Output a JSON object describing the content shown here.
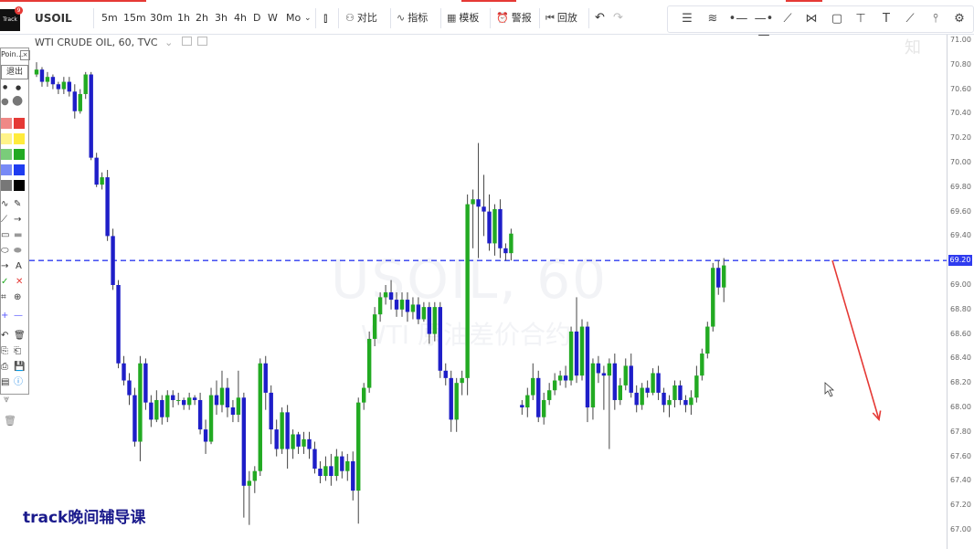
{
  "toolbar": {
    "symbol": "USOIL",
    "intervals": [
      "5m",
      "15m",
      "30m",
      "1h",
      "2h",
      "3h",
      "4h",
      "D",
      "W",
      "Mo"
    ],
    "compare": "对比",
    "indicators": "指标",
    "templates": "模板",
    "alert": "警报",
    "replay": "回放"
  },
  "drawing_tools": [
    "horizontal-lines-icon",
    "parallel-channel-icon",
    "horizontal-ray-icon",
    "horizontal-line-icon",
    "trend-line-icon",
    "pattern-icon",
    "rectangle-icon",
    "text-anchor-icon",
    "text-icon",
    "brush-icon",
    "vertical-line-icon",
    "settings-icon"
  ],
  "chart_header": {
    "title": "WTI CRUDE OIL, 60, TVC"
  },
  "watermark": {
    "symbol": "USOIL, 60",
    "name": "WTI 原油差价合约"
  },
  "left_panel": {
    "top_label": "Poin...",
    "exit_button": "退出",
    "text_tool": "A",
    "colors": [
      "#e53935",
      "#ffeb3b",
      "#22aa22",
      "#1e3cf0",
      "#000000"
    ]
  },
  "caption": "track晚间辅导课",
  "logo": {
    "text": "Track",
    "badge": "9"
  },
  "corner_mark": "知",
  "chart_data": {
    "type": "candlestick",
    "y_axis_ticks": [
      "71.00",
      "70.80",
      "70.60",
      "70.40",
      "70.20",
      "70.00",
      "69.80",
      "69.60",
      "69.40",
      "69.20",
      "69.00",
      "68.80",
      "68.60",
      "68.40",
      "68.20",
      "68.00",
      "67.80",
      "67.60",
      "67.40",
      "67.20",
      "67.00"
    ],
    "ylim": [
      66.9,
      71.03
    ],
    "current_price": "69.20",
    "dashed_level": 69.2,
    "colors": {
      "up": "#22aa22",
      "down": "#1e1ec8",
      "level": "#2f3bef",
      "arrow": "#e53935"
    },
    "candles": [
      [
        70.72,
        70.76,
        70.82,
        70.7
      ],
      [
        70.76,
        70.66,
        70.78,
        70.62
      ],
      [
        70.66,
        70.7,
        70.74,
        70.62
      ],
      [
        70.7,
        70.64,
        70.72,
        70.6
      ],
      [
        70.64,
        70.6,
        70.66,
        70.56
      ],
      [
        70.6,
        70.66,
        70.7,
        70.56
      ],
      [
        70.66,
        70.58,
        70.7,
        70.54
      ],
      [
        70.58,
        70.42,
        70.64,
        70.36
      ],
      [
        70.42,
        70.56,
        70.6,
        70.4
      ],
      [
        70.56,
        70.72,
        70.74,
        70.52
      ],
      [
        70.72,
        70.04,
        70.74,
        70.02
      ],
      [
        70.04,
        69.82,
        70.08,
        69.8
      ],
      [
        69.82,
        69.88,
        69.92,
        69.78
      ],
      [
        69.88,
        69.4,
        69.94,
        69.36
      ],
      [
        69.4,
        69.0,
        69.46,
        68.96
      ],
      [
        69.0,
        68.36,
        69.04,
        68.32
      ],
      [
        68.36,
        68.22,
        68.42,
        68.18
      ],
      [
        68.22,
        68.1,
        68.28,
        68.02
      ],
      [
        68.1,
        67.72,
        68.16,
        67.68
      ],
      [
        67.72,
        68.36,
        68.42,
        67.56
      ],
      [
        68.36,
        68.04,
        68.4,
        67.98
      ],
      [
        68.04,
        67.9,
        68.1,
        67.84
      ],
      [
        67.9,
        68.06,
        68.14,
        67.88
      ],
      [
        68.06,
        67.92,
        68.1,
        67.86
      ],
      [
        67.92,
        68.1,
        68.14,
        67.88
      ],
      [
        68.1,
        68.06,
        68.14,
        68.0
      ],
      [
        68.06,
        68.06,
        68.12,
        68.02
      ],
      [
        68.06,
        68.02,
        68.08,
        67.98
      ],
      [
        68.02,
        68.08,
        68.12,
        67.98
      ],
      [
        68.08,
        68.06,
        68.1,
        68.02
      ],
      [
        68.06,
        67.82,
        68.12,
        67.78
      ],
      [
        67.82,
        67.72,
        67.9,
        67.62
      ],
      [
        67.72,
        68.1,
        68.16,
        67.7
      ],
      [
        68.1,
        68.02,
        68.22,
        67.94
      ],
      [
        68.02,
        68.16,
        68.3,
        67.96
      ],
      [
        68.16,
        68.0,
        68.24,
        67.92
      ],
      [
        68.0,
        67.94,
        68.06,
        67.88
      ],
      [
        67.94,
        68.08,
        68.3,
        67.88
      ],
      [
        68.08,
        67.36,
        68.12,
        67.1
      ],
      [
        67.36,
        67.4,
        67.48,
        67.04
      ],
      [
        67.4,
        67.48,
        67.52,
        67.3
      ],
      [
        67.48,
        68.36,
        68.4,
        67.44
      ],
      [
        68.36,
        68.12,
        68.42,
        67.98
      ],
      [
        68.12,
        67.82,
        68.18,
        67.7
      ],
      [
        67.82,
        67.66,
        67.9,
        67.6
      ],
      [
        67.66,
        67.96,
        68.0,
        67.62
      ],
      [
        67.96,
        67.66,
        68.02,
        67.5
      ],
      [
        67.66,
        67.78,
        67.82,
        67.58
      ],
      [
        67.78,
        67.68,
        67.8,
        67.62
      ],
      [
        67.68,
        67.74,
        67.8,
        67.62
      ],
      [
        67.74,
        67.66,
        67.8,
        67.58
      ],
      [
        67.66,
        67.5,
        67.72,
        67.46
      ],
      [
        67.5,
        67.44,
        67.56,
        67.38
      ],
      [
        67.44,
        67.52,
        67.6,
        67.4
      ],
      [
        67.52,
        67.44,
        67.62,
        67.36
      ],
      [
        67.44,
        67.6,
        67.66,
        67.4
      ],
      [
        67.6,
        67.48,
        67.64,
        67.42
      ],
      [
        67.48,
        67.56,
        67.62,
        67.4
      ],
      [
        67.56,
        67.32,
        67.64,
        67.24
      ],
      [
        67.32,
        68.04,
        68.08,
        67.05
      ],
      [
        68.04,
        68.16,
        68.2,
        67.98
      ],
      [
        68.16,
        68.56,
        68.62,
        68.12
      ],
      [
        68.56,
        68.76,
        68.82,
        68.5
      ],
      [
        68.76,
        68.9,
        68.94,
        68.7
      ],
      [
        68.9,
        68.94,
        69.0,
        68.84
      ],
      [
        68.94,
        68.88,
        69.04,
        68.8
      ],
      [
        68.88,
        68.8,
        68.94,
        68.74
      ],
      [
        68.8,
        68.88,
        68.94,
        68.74
      ],
      [
        68.88,
        68.78,
        68.94,
        68.7
      ],
      [
        68.78,
        68.84,
        68.9,
        68.72
      ],
      [
        68.84,
        68.72,
        68.9,
        68.68
      ],
      [
        68.72,
        68.82,
        68.86,
        68.7
      ],
      [
        68.82,
        68.6,
        68.86,
        68.52
      ],
      [
        68.6,
        68.82,
        68.86,
        68.54
      ],
      [
        68.82,
        68.3,
        68.86,
        68.24
      ],
      [
        68.3,
        68.24,
        68.36,
        68.18
      ],
      [
        68.24,
        67.9,
        68.3,
        67.8
      ],
      [
        67.9,
        68.2,
        68.24,
        67.8
      ],
      [
        68.2,
        68.24,
        68.3,
        68.1
      ],
      [
        68.24,
        69.66,
        69.74,
        68.1
      ],
      [
        69.66,
        69.7,
        69.78,
        69.3
      ],
      [
        69.7,
        69.64,
        70.16,
        69.22
      ],
      [
        69.64,
        69.6,
        69.9,
        69.4
      ],
      [
        69.6,
        69.34,
        69.74,
        69.28
      ],
      [
        69.34,
        69.62,
        69.66,
        69.24
      ],
      [
        69.62,
        69.3,
        69.7,
        69.22
      ],
      [
        69.3,
        69.26,
        69.34,
        69.2
      ],
      [
        69.26,
        69.42,
        69.46,
        69.2
      ],
      [
        68.02,
        68.0,
        68.06,
        67.94
      ],
      [
        68.0,
        68.1,
        68.16,
        67.92
      ],
      [
        68.1,
        68.24,
        68.36,
        68.06
      ],
      [
        68.24,
        67.92,
        68.3,
        67.88
      ],
      [
        67.92,
        68.06,
        68.12,
        67.86
      ],
      [
        68.06,
        68.14,
        68.2,
        68.02
      ],
      [
        68.14,
        68.22,
        68.28,
        68.1
      ],
      [
        68.22,
        68.26,
        68.3,
        68.18
      ],
      [
        68.26,
        68.22,
        68.34,
        68.16
      ],
      [
        68.22,
        68.62,
        68.66,
        68.18
      ],
      [
        68.62,
        68.26,
        68.9,
        68.2
      ],
      [
        68.26,
        68.66,
        68.72,
        68.22
      ],
      [
        68.66,
        68.0,
        68.7,
        67.88
      ],
      [
        68.0,
        68.36,
        68.4,
        67.9
      ],
      [
        68.36,
        68.28,
        68.42,
        68.2
      ],
      [
        68.28,
        68.26,
        68.34,
        67.98
      ],
      [
        68.26,
        68.36,
        68.4,
        67.66
      ],
      [
        68.36,
        68.06,
        68.44,
        67.98
      ],
      [
        68.06,
        68.18,
        68.24,
        68.02
      ],
      [
        68.18,
        68.34,
        68.4,
        68.14
      ],
      [
        68.34,
        68.12,
        68.44,
        68.08
      ],
      [
        68.12,
        68.02,
        68.18,
        67.96
      ],
      [
        68.02,
        68.16,
        68.2,
        67.98
      ],
      [
        68.16,
        68.12,
        68.22,
        68.08
      ],
      [
        68.12,
        68.28,
        68.32,
        68.1
      ],
      [
        68.28,
        68.12,
        68.34,
        68.06
      ],
      [
        68.12,
        68.02,
        68.16,
        67.96
      ],
      [
        68.02,
        68.06,
        68.1,
        67.92
      ],
      [
        68.06,
        68.18,
        68.22,
        68.0
      ],
      [
        68.18,
        68.06,
        68.22,
        68.02
      ],
      [
        68.06,
        68.02,
        68.1,
        67.96
      ],
      [
        68.02,
        68.08,
        68.14,
        67.94
      ],
      [
        68.08,
        68.26,
        68.34,
        68.04
      ],
      [
        68.26,
        68.44,
        68.48,
        68.22
      ],
      [
        68.44,
        68.66,
        68.7,
        68.4
      ],
      [
        68.66,
        69.14,
        69.18,
        68.62
      ],
      [
        69.14,
        68.98,
        69.2,
        68.92
      ],
      [
        68.98,
        69.16,
        69.22,
        68.86
      ]
    ],
    "candle_positions": "gap of one bar after index 87",
    "annotation": {
      "type": "arrow",
      "from": [
        911,
        69.2
      ],
      "to": [
        962,
        67.9
      ]
    }
  }
}
